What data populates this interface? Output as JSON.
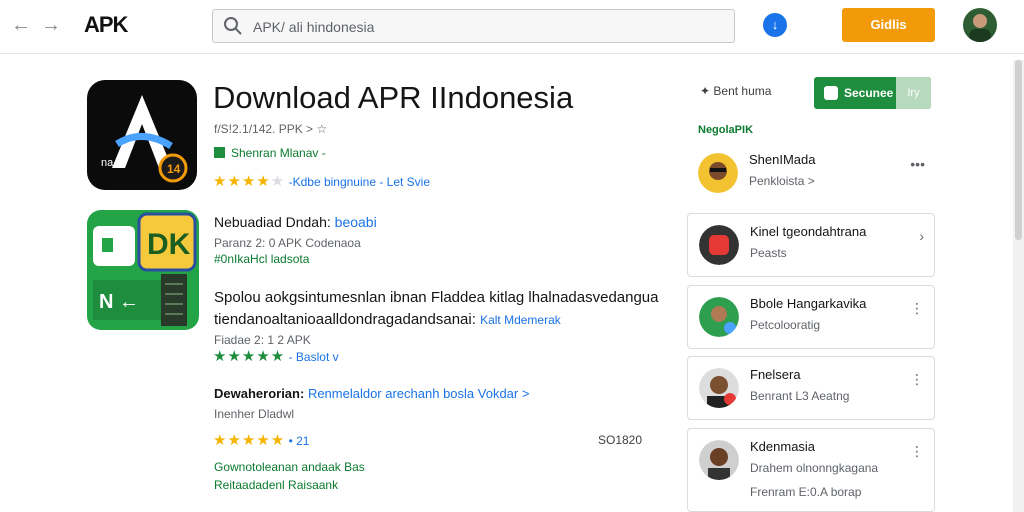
{
  "header": {
    "logo": "APK",
    "search_value": "APK/ ali hindonesia",
    "orange_button_label": "Gidlis"
  },
  "app": {
    "title": "Download APR IIndonesia",
    "meta": "f/S!2.1/142.  PPK >",
    "developer": "Shenran  Mlanav -",
    "rating_text": "-Kdbe  bingnuine  - Let Svie"
  },
  "related_card": {
    "title": "Nebuadiad  Dndah:",
    "title_link": "beoabi",
    "sub": "Paranz 2: 0 APK Codenaoa",
    "green": "#0nIkaHcl ladsota"
  },
  "description": {
    "line1": "Spolou aokgsintumesnlan  ibnan Fladdea  kitlag  lhalnadasvedangua",
    "line2": "tiendanoaltanioaalldondragadandsanai:",
    "line2_link": "Kalt  Mdemerak",
    "meta": "Fiadae 2: 1 2 APK",
    "rating_link": "- Baslot v"
  },
  "download": {
    "title": "Dewaherorian:",
    "title_link": "Renmelaldor  arechanh bosla  Vokdar  >",
    "sub": "Inenher  Dladwl",
    "rating_link": "• 21",
    "size": "SO1820",
    "green1": "Gownotoleanan  andaak Bas",
    "green2": "Reitaadadenl  Raisaank"
  },
  "sidebar": {
    "share_label": "Bent huma",
    "secure_label": "Secunee",
    "secure_right": "Iry",
    "heading": "NegolaPIK",
    "items": [
      {
        "name": "ShenIMada",
        "sub": "Penkloista  >"
      },
      {
        "name": "Kinel  tgeondahtrana",
        "sub": "Peasts"
      },
      {
        "name": "Bbole Hangarkavika",
        "sub": "Petcolooratig"
      },
      {
        "name": "Fnelsera",
        "sub": "Benrant  L3 Aeatng"
      },
      {
        "name": "Kdenmasia",
        "sub": "Drahem  olnonngkagana"
      }
    ],
    "items_extra": {
      "last_sub2": "Frenram  E:0.A borap"
    }
  },
  "colors": {
    "accent_green": "#1e8e3e",
    "accent_orange": "#f29a0a",
    "link_blue": "#1a73e8",
    "star_yellow": "#f4b400"
  }
}
